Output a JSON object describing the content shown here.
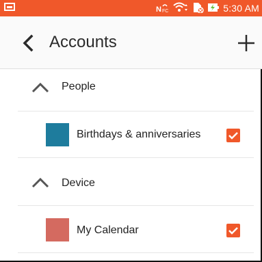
{
  "status_bar": {
    "time": "5:30 AM",
    "color": "#f0582a",
    "icons": [
      "image-notification-icon",
      "nfc-icon",
      "wifi-icon",
      "sim-icon",
      "battery-charging-icon"
    ]
  },
  "header": {
    "title": "Accounts",
    "back_icon": "chevron-left-icon",
    "add_icon": "plus-icon"
  },
  "groups": [
    {
      "label": "People",
      "calendars": [
        {
          "label": "Birthdays & anniversaries",
          "color": "#1e7c9d",
          "checked": true
        }
      ]
    },
    {
      "label": "Device",
      "calendars": [
        {
          "label": "My Calendar",
          "color": "#d46a60",
          "checked": true
        }
      ]
    }
  ],
  "accent": "#f0582a"
}
